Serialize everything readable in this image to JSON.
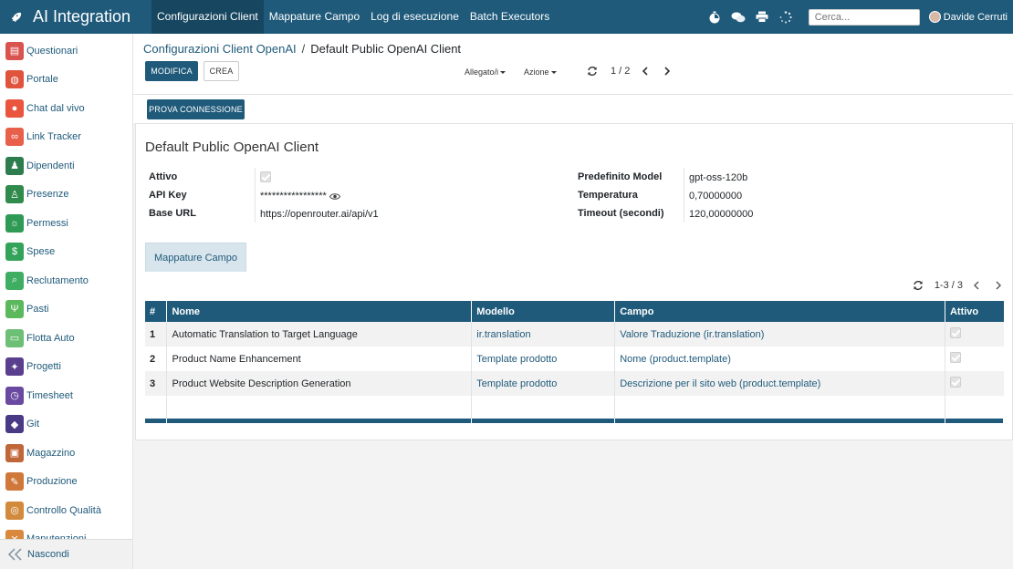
{
  "topbar": {
    "app_title": "AI Integration",
    "menu": [
      "Configurazioni Client",
      "Mappature Campo",
      "Log di esecuzione",
      "Batch Executors"
    ],
    "search_placeholder": "Cerca...",
    "user_name": "Davide Cerruti",
    "accent_color": "#1f5a7a"
  },
  "sidebar": {
    "items": [
      {
        "label": "Questionari",
        "color": "#d9534f",
        "icon": "clipboard-icon"
      },
      {
        "label": "Portale",
        "color": "#e0533c",
        "icon": "globe-icon"
      },
      {
        "label": "Chat dal vivo",
        "color": "#e9553f",
        "icon": "chat-bubbles-icon"
      },
      {
        "label": "Link Tracker",
        "color": "#e8604c",
        "icon": "link-icon"
      },
      {
        "label": "Dipendenti",
        "color": "#2e7d4f",
        "icon": "people-icon"
      },
      {
        "label": "Presenze",
        "color": "#2f8a4c",
        "icon": "person-icon"
      },
      {
        "label": "Permessi",
        "color": "#2f9a55",
        "icon": "sun-icon"
      },
      {
        "label": "Spese",
        "color": "#33a35a",
        "icon": "dollar-icon"
      },
      {
        "label": "Reclutamento",
        "color": "#3fae62",
        "icon": "search-person-icon"
      },
      {
        "label": "Pasti",
        "color": "#5cb85c",
        "icon": "cutlery-icon"
      },
      {
        "label": "Flotta Auto",
        "color": "#6cbf74",
        "icon": "car-icon"
      },
      {
        "label": "Progetti",
        "color": "#5b3f8f",
        "icon": "puzzle-icon"
      },
      {
        "label": "Timesheet",
        "color": "#6a4aa0",
        "icon": "clock-icon"
      },
      {
        "label": "Git",
        "color": "#4a3a86",
        "icon": "git-icon"
      },
      {
        "label": "Magazzino",
        "color": "#c0673a",
        "icon": "box-icon"
      },
      {
        "label": "Produzione",
        "color": "#d0783a",
        "icon": "wrench-icon"
      },
      {
        "label": "Controllo Qualità",
        "color": "#d28a3c",
        "icon": "quality-icon"
      },
      {
        "label": "Manutenzioni",
        "color": "#d9883d",
        "icon": "tools-icon"
      }
    ],
    "hide_label": "Nascondi"
  },
  "breadcrumb": {
    "parent": "Configurazioni Client OpenAI",
    "separator": "/",
    "current": "Default Public OpenAI Client"
  },
  "buttons": {
    "edit": "MODIFICA",
    "create": "CREA",
    "test_connection": "PROVA CONNESSIONE"
  },
  "dropdowns": {
    "attachments": "Allegato/i",
    "action": "Azione"
  },
  "pager": {
    "value": "1 / 2"
  },
  "record": {
    "title": "Default Public OpenAI Client",
    "left_fields": [
      {
        "label": "Attivo",
        "type": "checkbox",
        "checked": true
      },
      {
        "label": "API Key",
        "value": "*****************"
      },
      {
        "label": "Base URL",
        "value": "https://openrouter.ai/api/v1"
      }
    ],
    "right_fields": [
      {
        "label": "Predefinito Model",
        "value": "gpt-oss-120b"
      },
      {
        "label": "Temperatura",
        "value": "0,70000000"
      },
      {
        "label": "Timeout (secondi)",
        "value": "120,00000000"
      }
    ]
  },
  "tab": {
    "label": "Mappature Campo"
  },
  "mappings": {
    "pager": "1-3 / 3",
    "columns": [
      "#",
      "Nome",
      "Modello",
      "Campo",
      "Attivo"
    ],
    "rows": [
      {
        "idx": "1",
        "name": "Automatic Translation to Target Language",
        "model": "ir.translation",
        "field": "Valore Traduzione (ir.translation)",
        "active": true
      },
      {
        "idx": "2",
        "name": "Product Name Enhancement",
        "model": "Template prodotto",
        "field": "Nome (product.template)",
        "active": true
      },
      {
        "idx": "3",
        "name": "Product Website Description Generation",
        "model": "Template prodotto",
        "field": "Descrizione per il sito web (product.template)",
        "active": true
      }
    ]
  }
}
